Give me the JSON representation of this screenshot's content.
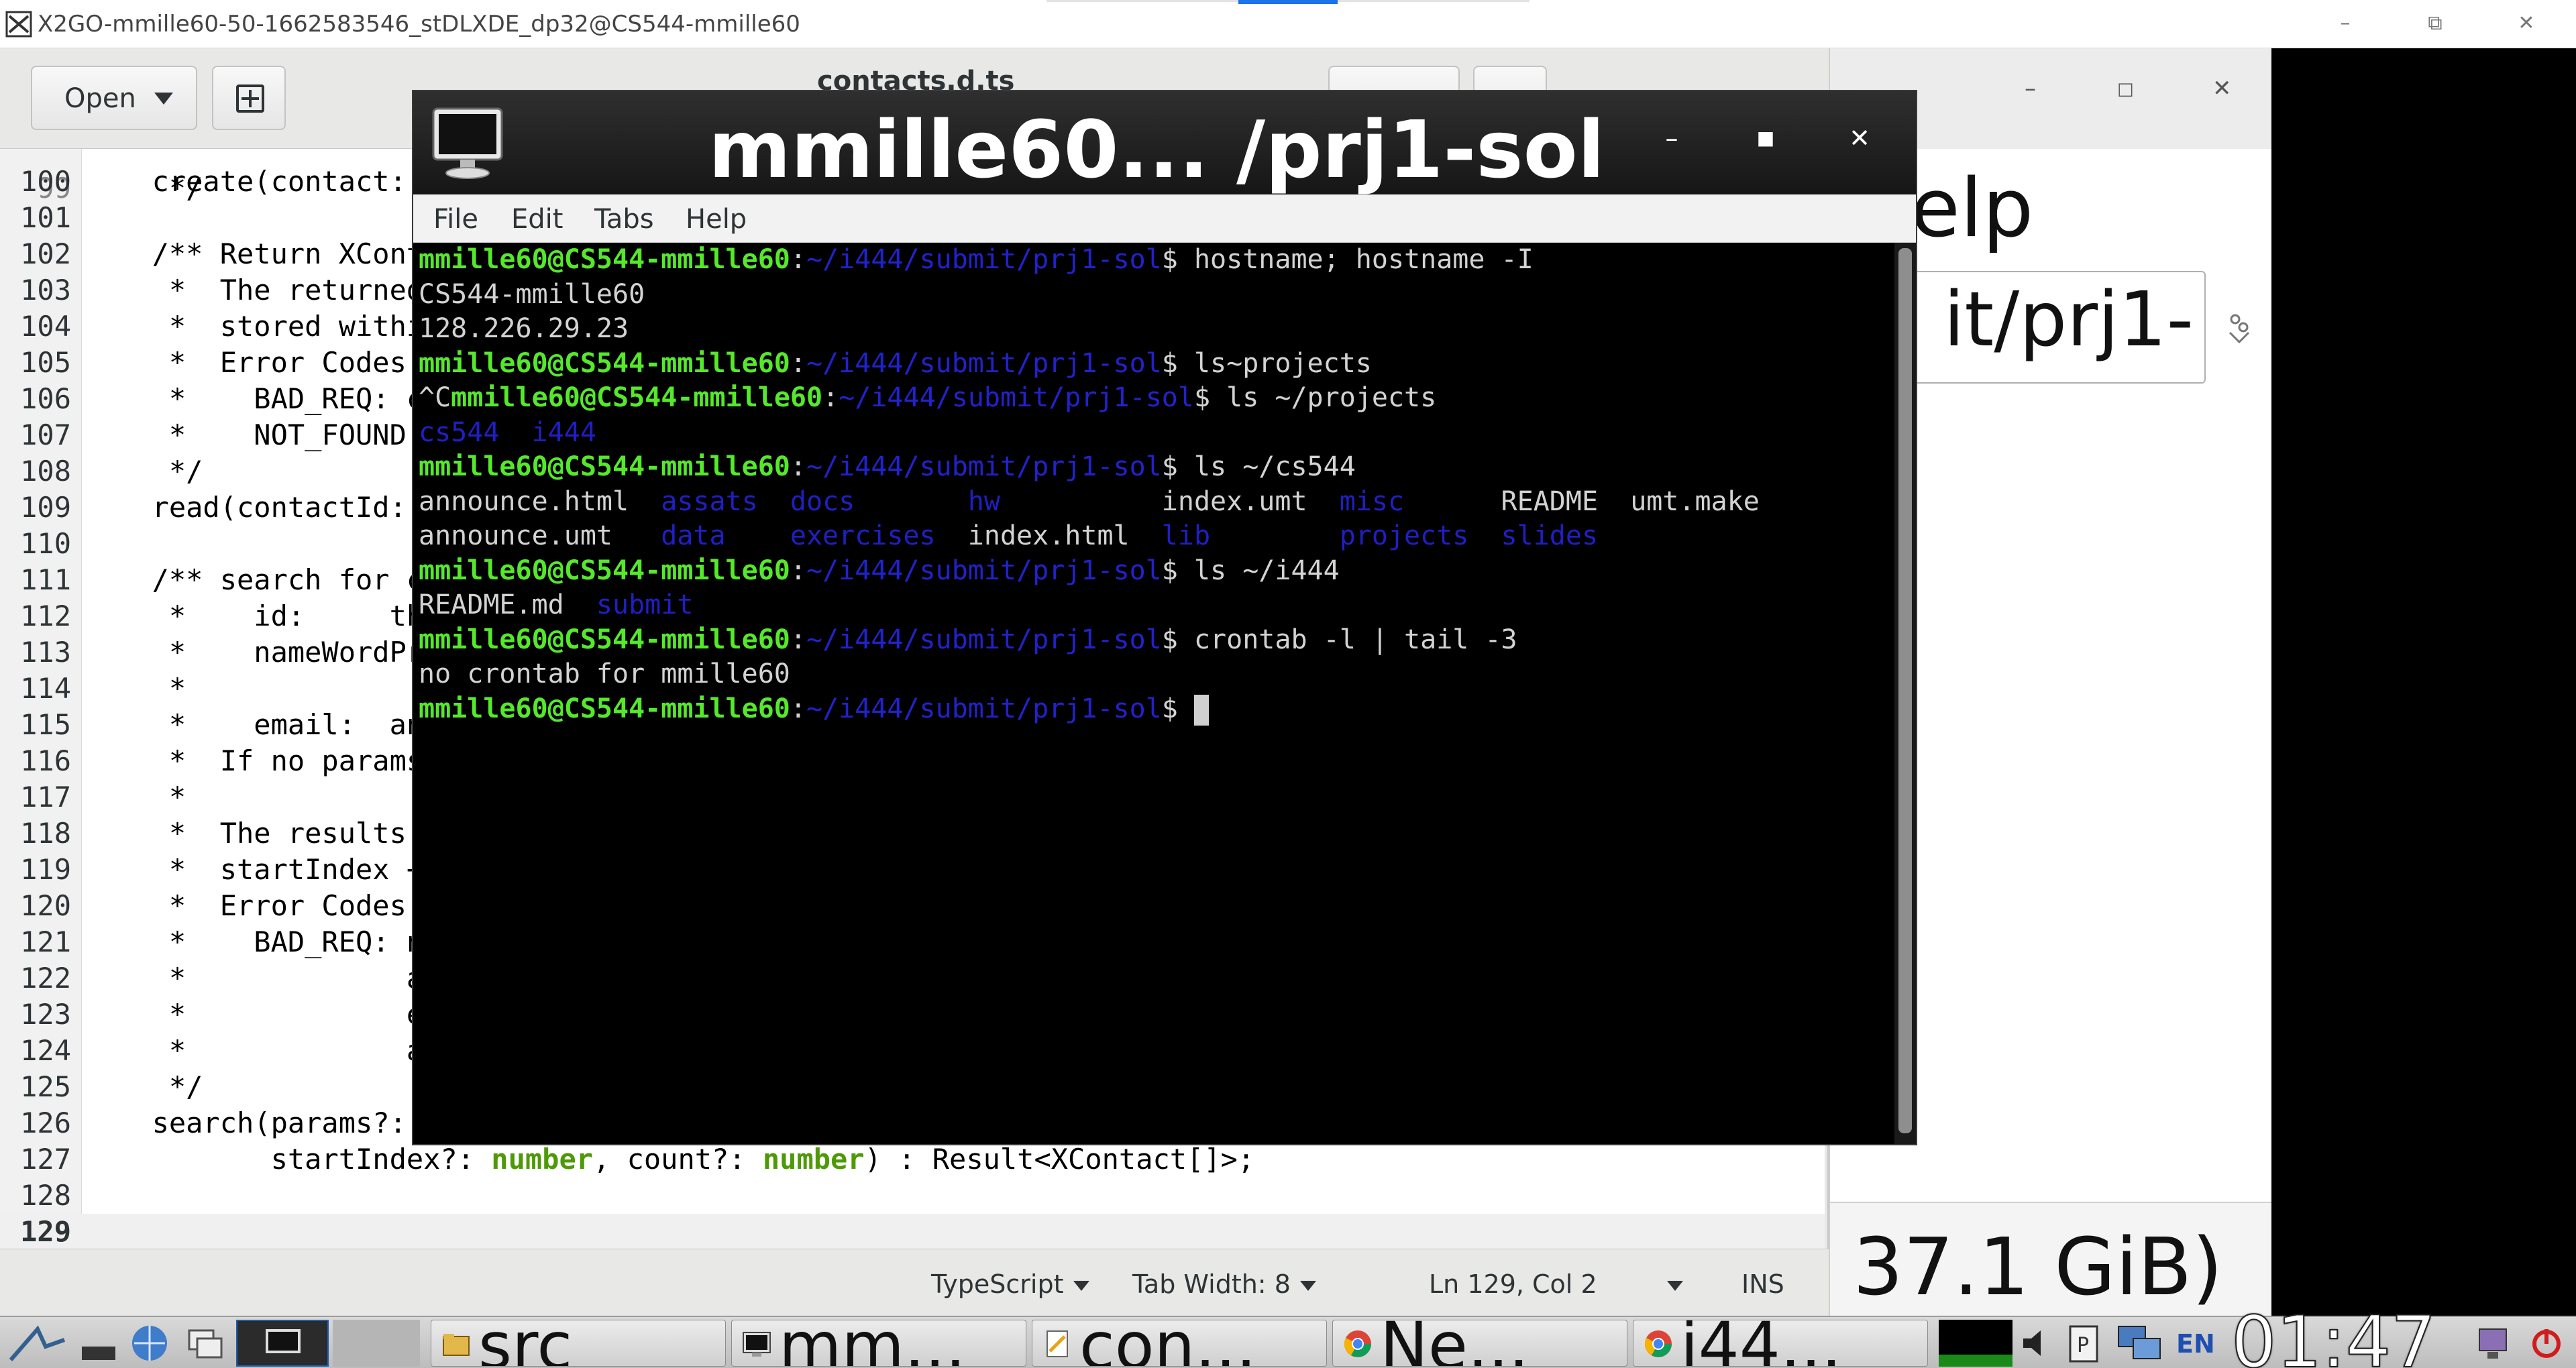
{
  "outer_window": {
    "title": "X2GO-mmille60-50-1662583546_stDLXDE_dp32@CS544-mmille60",
    "minimize_glyph": "–",
    "restore_glyph": "⧉",
    "close_glyph": "✕"
  },
  "gedit": {
    "open_label": "Open",
    "doc_title": "contacts.d.ts",
    "lines": [
      {
        "n": "100",
        "text": "  create(contact: C"
      },
      {
        "n": "101",
        "text": ""
      },
      {
        "n": "102",
        "text": "  /** Return XConta",
        "comment": true
      },
      {
        "n": "103",
        "text": "   *  The returned",
        "comment": true
      },
      {
        "n": "104",
        "text": "   *  stored withi",
        "comment": true
      },
      {
        "n": "105",
        "text": "   *  Error Codes:",
        "comment": true
      },
      {
        "n": "106",
        "text": "   *    BAD_REQ: co",
        "comment": true
      },
      {
        "n": "107",
        "text": "   *    NOT_FOUND:",
        "comment": true
      },
      {
        "n": "108",
        "text": "   */",
        "comment": true
      },
      {
        "n": "109",
        "text": "  read(contactId: "
      },
      {
        "n": "110",
        "text": ""
      },
      {
        "n": "111",
        "text": "  /** search for co",
        "comment": true
      },
      {
        "n": "112",
        "text": "   *    id:     the",
        "comment": true
      },
      {
        "n": "113",
        "text": "   *    nameWordPre",
        "comment": true
      },
      {
        "n": "114",
        "text": "   *               the",
        "comment": true
      },
      {
        "n": "115",
        "text": "   *    email:  an",
        "comment": true
      },
      {
        "n": "116",
        "text": "   *  If no params",
        "comment": true
      },
      {
        "n": "117",
        "text": "   *",
        "comment": true
      },
      {
        "n": "118",
        "text": "   *  The results a",
        "comment": true
      },
      {
        "n": "119",
        "text": "   *  startIndex +",
        "comment": true
      },
      {
        "n": "120",
        "text": "   *  Error Codes:",
        "comment": true
      },
      {
        "n": "121",
        "text": "   *    BAD_REQ: na",
        "comment": true
      },
      {
        "n": "122",
        "text": "   *             a",
        "comment": true
      },
      {
        "n": "123",
        "text": "   *             er",
        "comment": true
      },
      {
        "n": "124",
        "text": "   *             a",
        "comment": true
      },
      {
        "n": "125",
        "text": "   */",
        "comment": true
      },
      {
        "n": "126",
        "text": "  search(params?: {"
      },
      {
        "n": "127",
        "parts": [
          {
            "t": "         startIndex?: "
          },
          {
            "t": "number",
            "cls": "kw"
          },
          {
            "t": ", count?: "
          },
          {
            "t": "number",
            "cls": "kw"
          },
          {
            "t": ") : Result<XContact[]>;"
          }
        ]
      },
      {
        "n": "128",
        "text": ""
      },
      {
        "n": "129",
        "text": "",
        "current": true
      }
    ],
    "status": {
      "language": "TypeScript",
      "tab_width": "Tab Width: 8",
      "position": "Ln 129, Col 2",
      "mode": "INS"
    }
  },
  "terminal": {
    "title": "mmille60... /prj1-sol",
    "menu": [
      "File",
      "Edit",
      "Tabs",
      "Help"
    ],
    "lines": [
      [
        {
          "t": "mmille60@CS544-mmille60",
          "c": "pu"
        },
        {
          "t": ":"
        },
        {
          "t": "~/i444/submit/prj1-sol",
          "c": "pp"
        },
        {
          "t": "$ hostname; hostname -I"
        }
      ],
      [
        {
          "t": "CS544-mmille60"
        }
      ],
      [
        {
          "t": "128.226.29.23"
        }
      ],
      [
        {
          "t": "mmille60@CS544-mmille60",
          "c": "pu"
        },
        {
          "t": ":"
        },
        {
          "t": "~/i444/submit/prj1-sol",
          "c": "pp"
        },
        {
          "t": "$ ls~projects"
        }
      ],
      [
        {
          "t": "^C"
        },
        {
          "t": "mmille60@CS544-mmille60",
          "c": "pu"
        },
        {
          "t": ":"
        },
        {
          "t": "~/i444/submit/prj1-sol",
          "c": "pp"
        },
        {
          "t": "$ ls ~/projects"
        }
      ],
      [
        {
          "t": "cs544",
          "c": "dir"
        },
        {
          "t": "  "
        },
        {
          "t": "i444",
          "c": "dir"
        }
      ],
      [
        {
          "t": "mmille60@CS544-mmille60",
          "c": "pu"
        },
        {
          "t": ":"
        },
        {
          "t": "~/i444/submit/prj1-sol",
          "c": "pp"
        },
        {
          "t": "$ ls ~/cs544"
        }
      ],
      [
        {
          "t": "announce.html  "
        },
        {
          "t": "assats",
          "c": "dir"
        },
        {
          "t": "  "
        },
        {
          "t": "docs",
          "c": "dir"
        },
        {
          "t": "       "
        },
        {
          "t": "hw",
          "c": "dir"
        },
        {
          "t": "          index.umt  "
        },
        {
          "t": "misc",
          "c": "dir"
        },
        {
          "t": "      README  umt.make"
        }
      ],
      [
        {
          "t": "announce.umt   "
        },
        {
          "t": "data",
          "c": "dir"
        },
        {
          "t": "    "
        },
        {
          "t": "exercises",
          "c": "dir"
        },
        {
          "t": "  index.html  "
        },
        {
          "t": "lib",
          "c": "dir"
        },
        {
          "t": "        "
        },
        {
          "t": "projects",
          "c": "dir"
        },
        {
          "t": "  "
        },
        {
          "t": "slides",
          "c": "dir"
        }
      ],
      [
        {
          "t": "mmille60@CS544-mmille60",
          "c": "pu"
        },
        {
          "t": ":"
        },
        {
          "t": "~/i444/submit/prj1-sol",
          "c": "pp"
        },
        {
          "t": "$ ls ~/i444"
        }
      ],
      [
        {
          "t": "README.md  "
        },
        {
          "t": "submit",
          "c": "dir"
        }
      ],
      [
        {
          "t": "mmille60@CS544-mmille60",
          "c": "pu"
        },
        {
          "t": ":"
        },
        {
          "t": "~/i444/submit/prj1-sol",
          "c": "pp"
        },
        {
          "t": "$ crontab -l | tail -3"
        }
      ],
      [
        {
          "t": "no crontab for mmille60"
        }
      ],
      [
        {
          "t": "mmille60@CS544-mmille60",
          "c": "pu"
        },
        {
          "t": ":"
        },
        {
          "t": "~/i444/submit/prj1-sol",
          "c": "pp"
        },
        {
          "t": "$ "
        },
        {
          "cursor": true
        }
      ]
    ]
  },
  "right_window": {
    "help_text": "elp",
    "path_text": "it/prj1-",
    "size_text": "37.1 GiB)"
  },
  "taskbar": {
    "tasks": [
      {
        "label": "src",
        "icon": "folder-icon"
      },
      {
        "label": "mm...",
        "icon": "terminal-icon"
      },
      {
        "label": "con...",
        "icon": "text-editor-icon"
      },
      {
        "label": "Ne...",
        "icon": "chrome-icon"
      },
      {
        "label": "i44...",
        "icon": "chrome-icon"
      }
    ],
    "lang": "EN",
    "clock": "01:47"
  },
  "colors": {
    "prompt_user": "#55e82b",
    "prompt_path": "#2222cc",
    "directory": "#1f1fc4",
    "keyword": "#4e9a06",
    "comment": "#1d45a8"
  }
}
